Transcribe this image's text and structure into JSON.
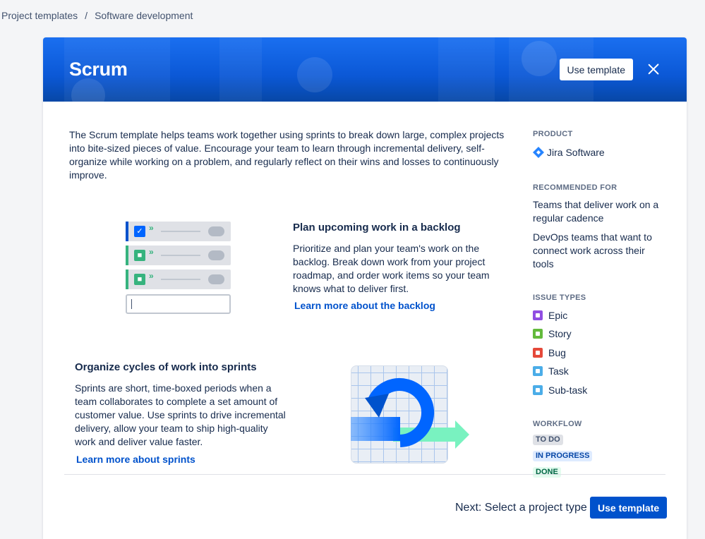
{
  "breadcrumb": [
    "Project templates",
    "/",
    "Software development"
  ],
  "header": {
    "title": "Scrum",
    "use_template_label": "Use template"
  },
  "intro": "The Scrum template helps teams work together using sprints to break down large, complex projects into bite-sized pieces of value. Encourage your team to learn through incremental delivery, self-organize while working on a problem, and regularly reflect on their wins and losses to continuously improve.",
  "features": [
    {
      "title": "Plan upcoming work in a backlog",
      "text": "Prioritize and plan your team's work on the backlog. Break down work from your project roadmap, and order work items so your team knows what to deliver first.",
      "link": "Learn more about the backlog"
    },
    {
      "title": "Organize cycles of work into sprints",
      "text": "Sprints are short, time-boxed periods when a team collaborates to complete a set amount of customer value. Use sprints to drive incremental delivery, allow your team to ship high-quality work and deliver value faster.",
      "link": "Learn more about sprints"
    }
  ],
  "sidebar": {
    "product_label": "PRODUCT",
    "product": "Jira Software",
    "recommended_label": "RECOMMENDED FOR",
    "recommended": [
      "Teams that deliver work on a regular cadence",
      "DevOps teams that want to connect work across their tools"
    ],
    "issue_types_label": "ISSUE TYPES",
    "issue_types": [
      {
        "name": "Epic",
        "color": "#904ee2"
      },
      {
        "name": "Story",
        "color": "#63ba3c"
      },
      {
        "name": "Bug",
        "color": "#e5493a"
      },
      {
        "name": "Task",
        "color": "#4bade8"
      },
      {
        "name": "Sub-task",
        "color": "#4bade8"
      }
    ],
    "workflow_label": "WORKFLOW",
    "workflow": [
      {
        "name": "TO DO",
        "bg": "#dfe1e6",
        "fg": "#42526e"
      },
      {
        "name": "IN PROGRESS",
        "bg": "#deebff",
        "fg": "#0747a6"
      },
      {
        "name": "DONE",
        "bg": "#e3fcef",
        "fg": "#006644"
      }
    ]
  },
  "footer": {
    "next_text": "Next: Select a project type",
    "use_template_label": "Use template"
  }
}
